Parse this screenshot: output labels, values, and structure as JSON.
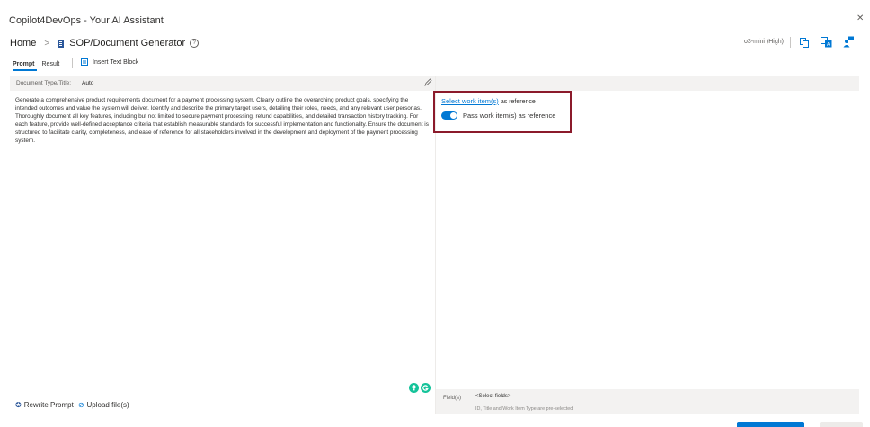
{
  "app": {
    "title": "Copilot4DevOps - Your AI Assistant"
  },
  "breadcrumb": {
    "home": "Home",
    "separator": ">",
    "page": "SOP/Document Generator",
    "help_glyph": "?"
  },
  "header": {
    "model": "o3-mini (High)"
  },
  "tabs": [
    {
      "label": "Prompt",
      "active": true
    },
    {
      "label": "Result",
      "active": false
    }
  ],
  "toolbar": {
    "insert_text_block": "Insert Text Block"
  },
  "document": {
    "type_label": "Document Type/Title:",
    "type_value": "Auto",
    "prompt_text": "Generate a comprehensive product requirements document for a payment processing system. Clearly outline the overarching product goals, specifying the intended outcomes and value the system will deliver. Identify and describe the primary target users, detailing their roles, needs, and any relevant user personas. Thoroughly document all key features, including but not limited to secure payment processing, refund capabilities, and detailed transaction history tracking. For each feature, provide well-defined acceptance criteria that establish measurable standards for successful implementation and functionality. Ensure the document is structured to facilitate clarity, completeness, and ease of reference for all stakeholders involved in the development and deployment of the payment processing system."
  },
  "actions": {
    "rewrite_prompt": "Rewrite Prompt",
    "upload_files": "Upload file(s)"
  },
  "reference": {
    "select_link": "Select work item(s)",
    "as_reference": "as reference",
    "toggle_label": "Pass work item(s) as reference",
    "toggle_on": true
  },
  "fields": {
    "label": "Field(s)",
    "select_placeholder": "<Select fields>",
    "note": "ID, Title and Work Item Type are pre-selected"
  },
  "colors": {
    "accent": "#0078d4",
    "highlight_border": "#8b1a2b",
    "grammarly": "#15c39a"
  },
  "icons": {
    "close": "✕",
    "chevron": ">",
    "pencil": "pencil-icon",
    "rewrite": "✪",
    "upload": "⊘"
  }
}
